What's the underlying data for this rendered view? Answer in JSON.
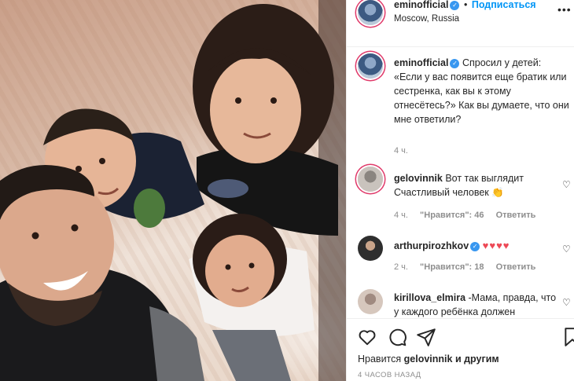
{
  "post": {
    "username": "eminofficial",
    "verified_badge": "✓",
    "dot": "•",
    "follow_label": "Подписаться",
    "location": "Moscow, Russia",
    "more_icon": "more-horizontal-icon",
    "more_glyph": "•••"
  },
  "caption": {
    "username": "eminofficial",
    "text": "Спросил у детей: «Если у вас появится еще братик или сестренка, как вы к этому отнесётесь?» Как вы думаете, что они мне ответили?",
    "time": "4 ч."
  },
  "comments": [
    {
      "username": "gelovinnik",
      "text": "Вот так выглядит Счастливый человек 👏",
      "time": "4 ч.",
      "likes": "\"Нравится\": 46",
      "reply": "Ответить",
      "avatar_color": "#c9c3bd"
    },
    {
      "username": "arthurpirozhkov",
      "verified_badge": "✓",
      "text": "♥♥♥♥",
      "time": "2 ч.",
      "likes": "\"Нравится\": 18",
      "reply": "Ответить",
      "avatar_color": "#2e2e2e"
    },
    {
      "username": "kirillova_elmira",
      "text": "-Мама, правда, что у каждого ребёнка должен",
      "avatar_color": "#d6c7bd"
    }
  ],
  "actions": {
    "icons": [
      "heart-icon",
      "comment-icon",
      "share-icon",
      "bookmark-icon"
    ],
    "likes_prefix": "Нравится",
    "likes_user": "gelovinnik",
    "likes_suffix": "и другим",
    "post_time": "4 ЧАСОВ НАЗАД"
  },
  "colors": {
    "accent": "#0095f6",
    "verified": "#3897f0",
    "meta_text": "#8e8e8e",
    "heart_red": "#ed4956"
  }
}
